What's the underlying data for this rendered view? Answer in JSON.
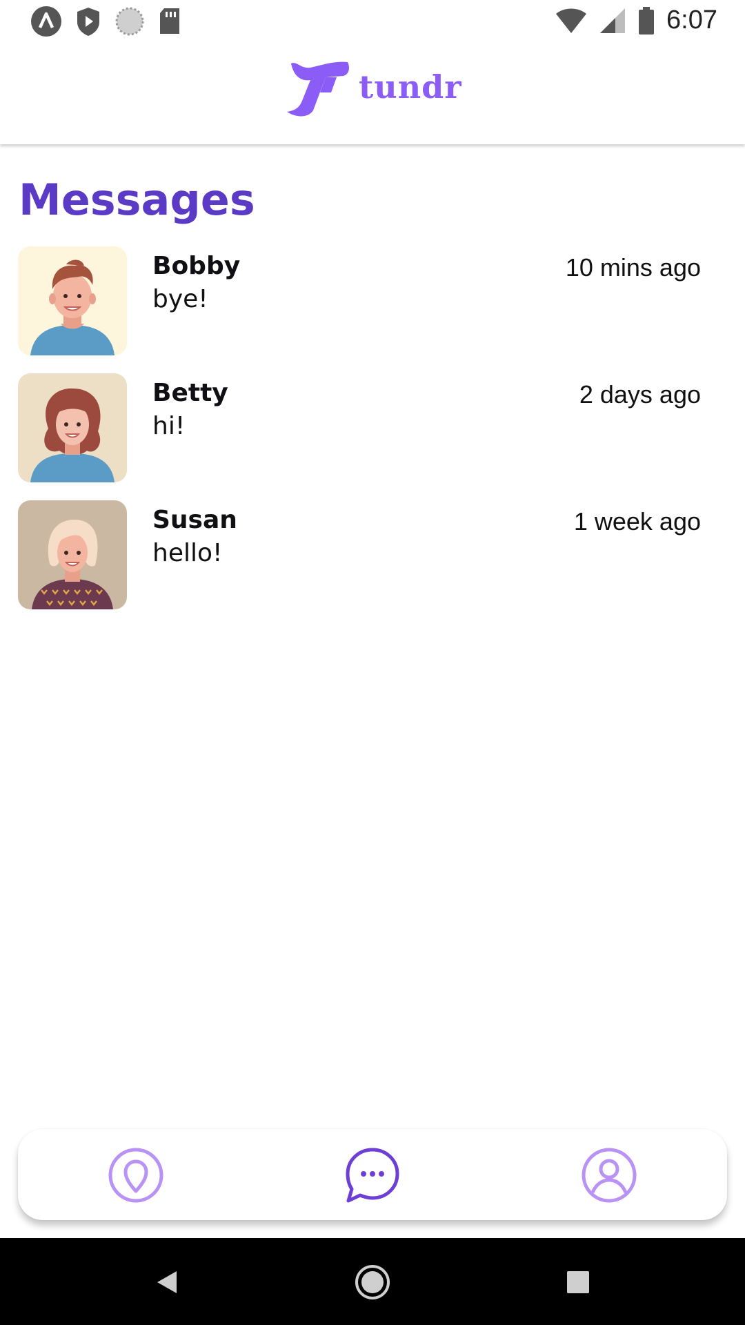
{
  "status_bar": {
    "time": "6:07",
    "left_icons": [
      "app-icon",
      "shield-play-icon",
      "loading-icon",
      "sd-card-icon"
    ],
    "right_icons": [
      "wifi-icon",
      "signal-icon",
      "battery-icon"
    ]
  },
  "header": {
    "logo_text": "tundr",
    "brand_color": "#8b5cf6"
  },
  "page": {
    "title": "Messages",
    "title_color": "#5b3bc6"
  },
  "conversations": [
    {
      "name": "Bobby",
      "last_message": "bye!",
      "time": "10 mins ago",
      "avatar_icon": "avatar-bobby-icon"
    },
    {
      "name": "Betty",
      "last_message": "hi!",
      "time": "2 days ago",
      "avatar_icon": "avatar-betty-icon"
    },
    {
      "name": "Susan",
      "last_message": "hello!",
      "time": "1 week ago",
      "avatar_icon": "avatar-susan-icon"
    }
  ],
  "tab_bar": {
    "tabs": [
      {
        "id": "map",
        "icon": "map-pin-icon",
        "active": false
      },
      {
        "id": "messages",
        "icon": "chat-bubble-icon",
        "active": true
      },
      {
        "id": "profile",
        "icon": "profile-icon",
        "active": false
      }
    ],
    "active_color": "#6d3fd6",
    "inactive_color": "#b892f5"
  },
  "nav_bar": {
    "buttons": [
      "back-icon",
      "home-icon",
      "recents-icon"
    ]
  }
}
